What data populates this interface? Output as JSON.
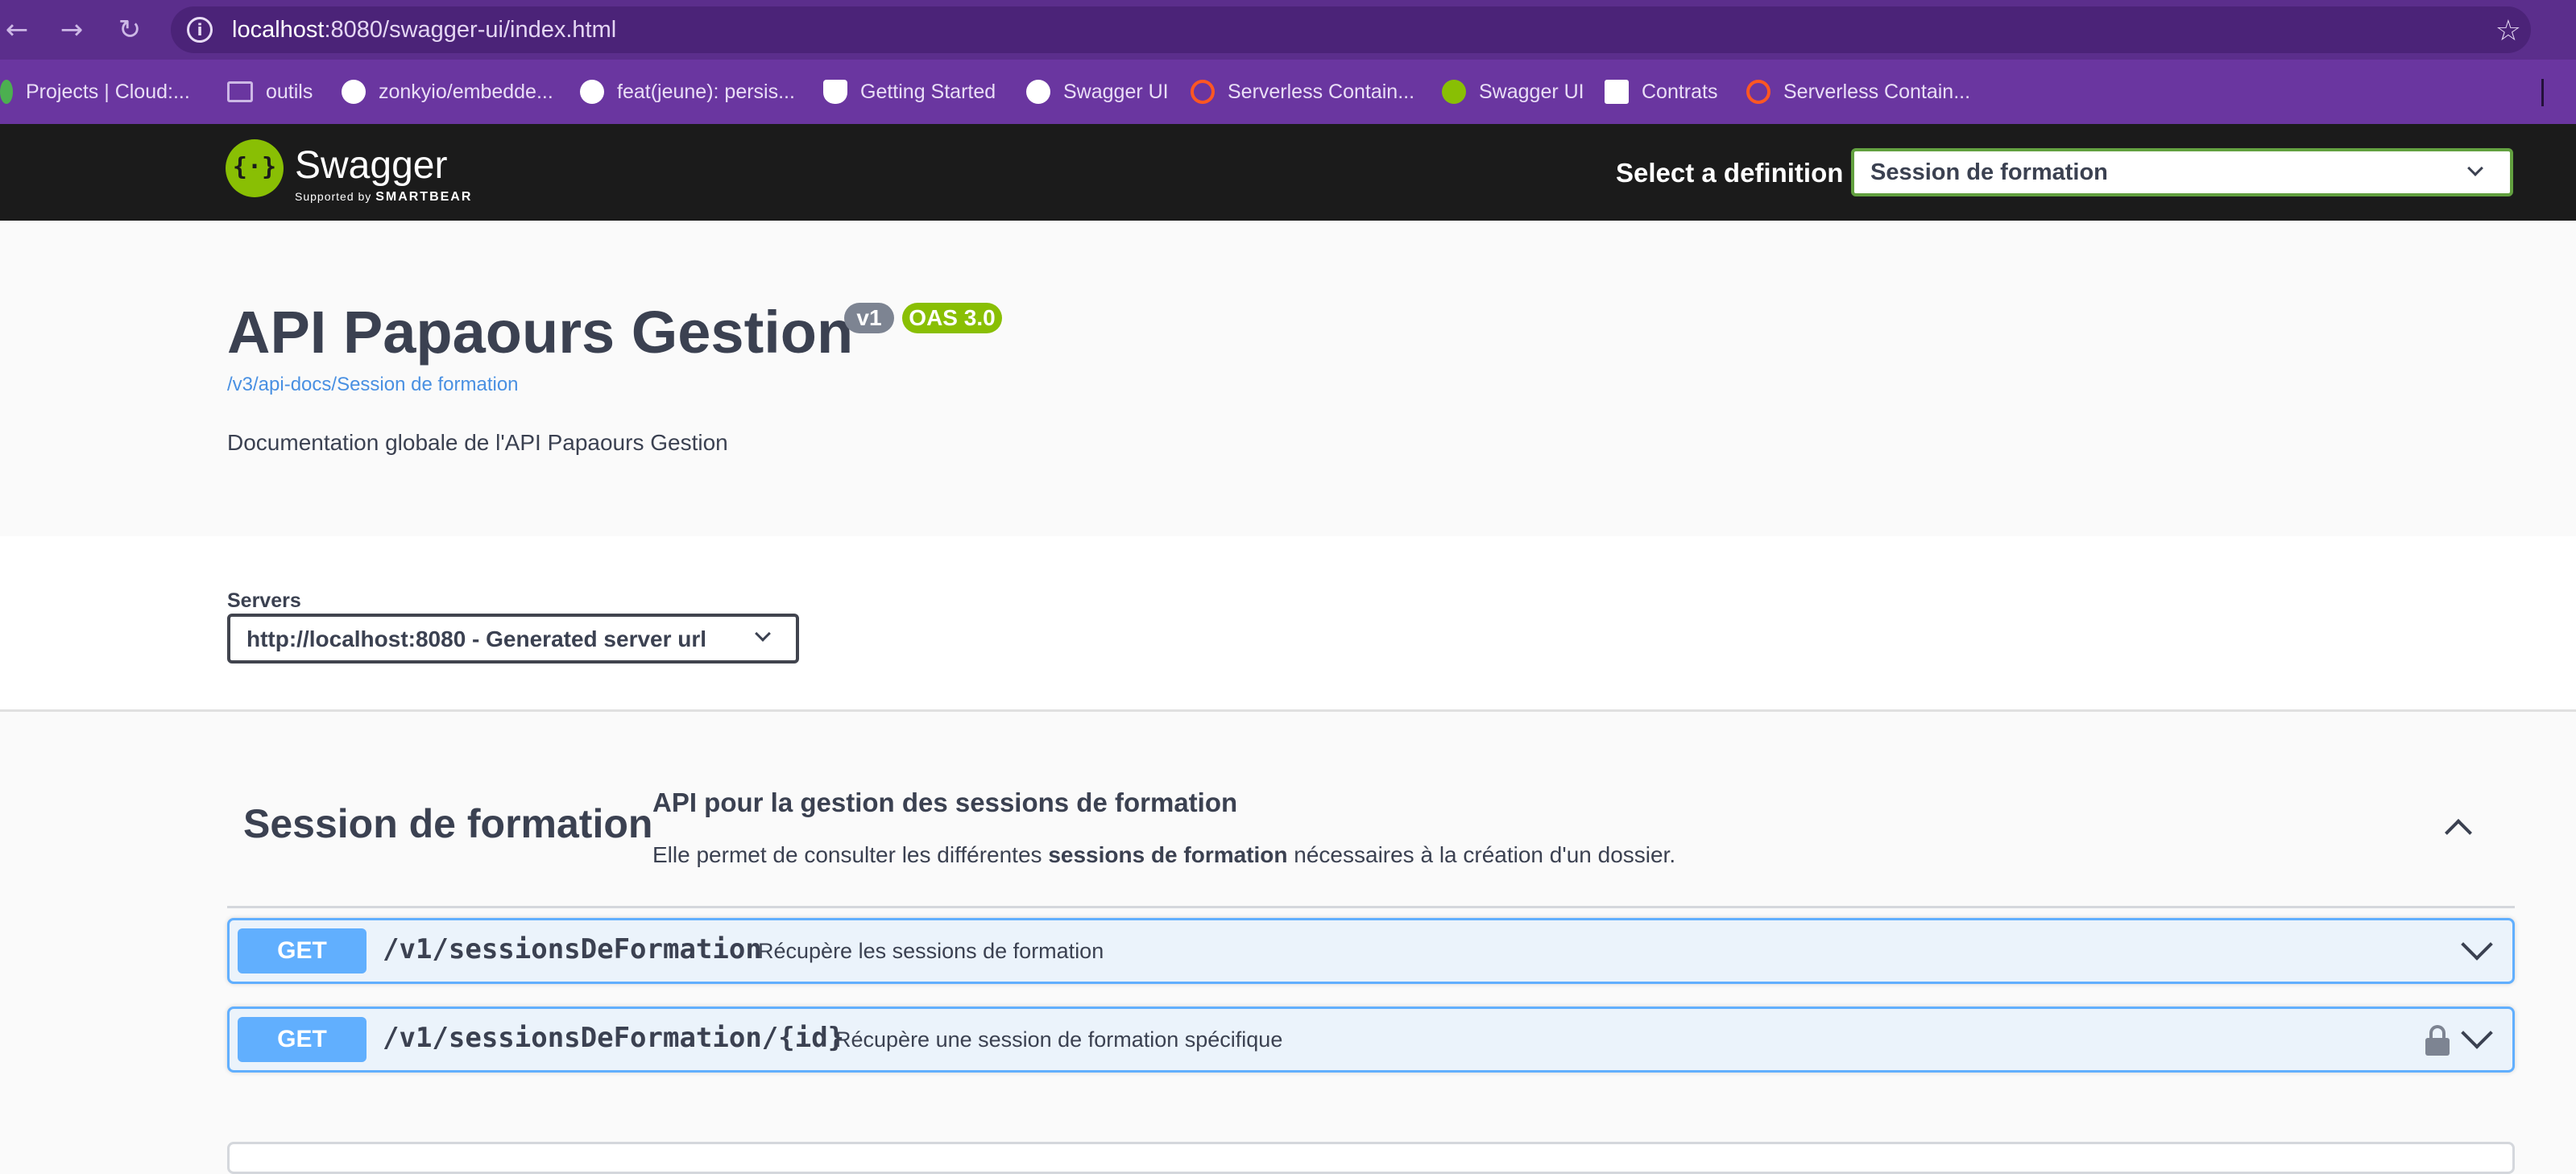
{
  "browser": {
    "url_host": "localhost",
    "url_rest": ":8080/swagger-ui/index.html",
    "bookmarks": [
      {
        "label": "Projects | Cloud:...",
        "icon": "leaf-icon",
        "color": "#4caf50"
      },
      {
        "label": "outils",
        "icon": "folder-icon",
        "color": "#cdb8e6"
      },
      {
        "label": "zonkyio/embedde...",
        "icon": "github-icon",
        "color": "#ffffff"
      },
      {
        "label": "feat(jeune): persis...",
        "icon": "github-icon",
        "color": "#ffffff"
      },
      {
        "label": "Getting Started",
        "icon": "shield-icon",
        "color": "#ffffff"
      },
      {
        "label": "Swagger UI",
        "icon": "globe-icon",
        "color": "#ffffff"
      },
      {
        "label": "Serverless Contain...",
        "icon": "gear-icon",
        "color": "#ff5722"
      },
      {
        "label": "Swagger UI",
        "icon": "swagger-icon",
        "color": "#89bf04"
      },
      {
        "label": "Contrats",
        "icon": "document-icon",
        "color": "#ffffff"
      },
      {
        "label": "Serverless Contain...",
        "icon": "gear-icon",
        "color": "#ff5722"
      }
    ]
  },
  "topbar": {
    "brand": "Swagger",
    "supported_by": "Supported by",
    "smartbear": "SMARTBEAR",
    "definition_label": "Select a definition",
    "definition_value": "Session de formation"
  },
  "info": {
    "title": "API Papaours Gestion",
    "version": "v1",
    "oas": "OAS 3.0",
    "doc_link": "/v3/api-docs/Session de formation",
    "description": "Documentation globale de l'API Papaours Gestion"
  },
  "servers": {
    "label": "Servers",
    "selected": "http://localhost:8080 - Generated server url"
  },
  "tag": {
    "name": "Session de formation",
    "title": "API pour la gestion des sessions de formation",
    "desc_before": "Elle permet de consulter les différentes ",
    "desc_bold": "sessions de formation",
    "desc_after": " nécessaires à la création d'un dossier."
  },
  "operations": [
    {
      "method": "GET",
      "path": "/v1/sessionsDeFormation",
      "summary": "Récupère les sessions de formation"
    },
    {
      "method": "GET",
      "path": "/v1/sessionsDeFormation/{id}",
      "summary": "Récupère une session de formation spécifique"
    }
  ],
  "colors": {
    "get_method": "#61affe",
    "swagger_green": "#89bf04",
    "browser_purple": "#5b2e8c"
  }
}
